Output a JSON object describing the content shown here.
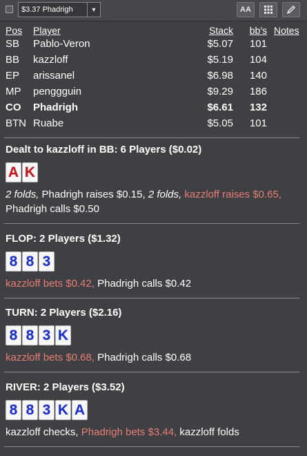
{
  "toolbar": {
    "selected_hand": "$3.37 Phadrigh",
    "font_size_label": "AA"
  },
  "players": {
    "headers": {
      "pos": "Pos",
      "player": "Player",
      "stack": "Stack",
      "bbs": "bb's",
      "notes": "Notes"
    },
    "rows": [
      {
        "pos": "SB",
        "player": "Pablo-Veron",
        "stack": "$5.07",
        "bbs": "101"
      },
      {
        "pos": "BB",
        "player": "kazzloff",
        "stack": "$5.19",
        "bbs": "104"
      },
      {
        "pos": "EP",
        "player": "arissanel",
        "stack": "$6.98",
        "bbs": "140"
      },
      {
        "pos": "MP",
        "player": "penggguin",
        "stack": "$9.29",
        "bbs": "186"
      },
      {
        "pos": "CO",
        "player": "Phadrigh",
        "stack": "$6.61",
        "bbs": "132"
      },
      {
        "pos": "BTN",
        "player": "Ruabe",
        "stack": "$5.05",
        "bbs": "101"
      }
    ]
  },
  "preflop": {
    "title": "Dealt to kazzloff in BB: 6 Players ($0.02)",
    "cards": [
      "A",
      "K"
    ],
    "a1": "2 folds,",
    "a2": " Phadrigh raises $0.15, ",
    "a3": "2 folds,",
    "a4": " kazzloff raises $0.65,",
    "a5": "Phadrigh calls $0.50"
  },
  "flop": {
    "title": "FLOP: 2 Players ($1.32)",
    "cards": [
      "8",
      "8",
      "3"
    ],
    "a1": "kazzloff bets $0.42,",
    "a2": " Phadrigh calls $0.42"
  },
  "turn": {
    "title": "TURN: 2 Players ($2.16)",
    "cards": [
      "8",
      "8",
      "3",
      "K"
    ],
    "a1": "kazzloff bets $0.68,",
    "a2": " Phadrigh calls $0.68"
  },
  "river": {
    "title": "RIVER: 2 Players ($3.52)",
    "cards": [
      "8",
      "8",
      "3",
      "K",
      "A"
    ],
    "a1": "kazzloff checks, ",
    "a2": "Phadrigh bets $3.44,",
    "a3": " kazzloff folds"
  },
  "colors": {
    "background": "#3f4043",
    "highlight": "#e87d76",
    "red_suit": "#c0171f",
    "blue_suit": "#1c2fc7"
  }
}
